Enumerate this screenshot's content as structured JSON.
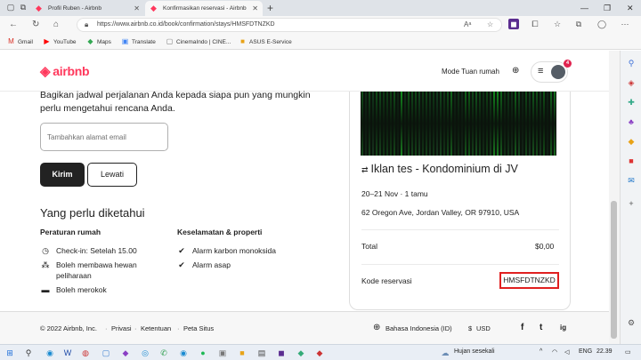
{
  "browser": {
    "tabs": [
      {
        "label": "Profil Ruben - Airbnb",
        "active": false
      },
      {
        "label": "Konfirmasikan reservasi - Airbnb",
        "active": true
      }
    ],
    "url": "https://www.airbnb.co.id/book/confirmation/stays/HMSFDTNZKD",
    "bookmarks": [
      "Gmail",
      "YouTube",
      "Maps",
      "Translate",
      "CinemaIndo | CINE...",
      "ASUS E-Service"
    ]
  },
  "header": {
    "logo_text": "airbnb",
    "host_link": "Mode Tuan rumah",
    "notification_count": "4"
  },
  "share": {
    "text": "Bagikan jadwal perjalanan Anda kepada siapa pun yang mungkin perlu mengetahui rencana Anda.",
    "email_placeholder": "Tambahkan alamat email",
    "send_label": "Kirim",
    "skip_label": "Lewati"
  },
  "know": {
    "title": "Yang perlu diketahui",
    "house_rules_title": "Peraturan rumah",
    "house_rules": [
      "Check-in: Setelah 15.00",
      "Boleh membawa hewan peliharaan",
      "Boleh merokok"
    ],
    "safety_title": "Keselamatan & properti",
    "safety": [
      "Alarm karbon monoksida",
      "Alarm asap"
    ]
  },
  "listing": {
    "title": "Iklan tes - Kondominium di JV",
    "dates": "20–21 Nov · 1 tamu",
    "address": "62 Oregon Ave, Jordan Valley, OR 97910, USA",
    "total_label": "Total",
    "total_value": "$0,00",
    "code_label": "Kode reservasi",
    "code_value": "HMSFDTNZKD"
  },
  "footer": {
    "copyright": "© 2022 Airbnb, Inc.",
    "links": [
      "Privasi",
      "Ketentuan",
      "Peta Situs"
    ],
    "language": "Bahasa Indonesia (ID)",
    "currency_symbol": "$",
    "currency": "USD",
    "social": [
      "f",
      "t",
      "ig"
    ]
  },
  "taskbar": {
    "weather": "Hujan sesekali",
    "lang": "ENG",
    "time": "22.39"
  },
  "colors": {
    "brand": "#ff385c",
    "highlight_border": "#e02020"
  }
}
